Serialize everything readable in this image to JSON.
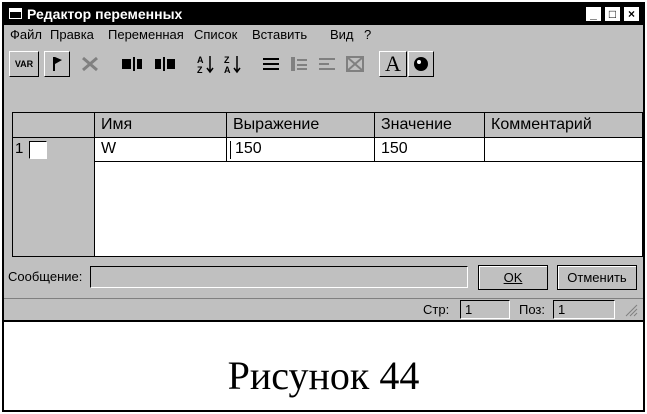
{
  "window": {
    "title": "Редактор переменных",
    "buttons": [
      "_",
      "□",
      "×"
    ]
  },
  "menu": [
    {
      "label": "Файл"
    },
    {
      "label": "Правка"
    },
    {
      "label": "Переменная"
    },
    {
      "label": "Список"
    },
    {
      "label": "Вставить"
    },
    {
      "label": "Вид"
    },
    {
      "label": "?"
    }
  ],
  "toolbar": {
    "var_label": "VAR",
    "font_label": "A"
  },
  "table": {
    "columns": [
      "Имя",
      "Выражение",
      "Значение",
      "Комментарий"
    ],
    "rows": [
      {
        "index": "1",
        "name": "W",
        "expression": "150",
        "value": "150",
        "comment": ""
      }
    ]
  },
  "message": {
    "label": "Сообщение:",
    "value": ""
  },
  "buttons": {
    "ok": "OK",
    "cancel": "Отменить"
  },
  "statusbar": {
    "page_label": "Стр:",
    "page_value": "1",
    "pos_label": "Поз:",
    "pos_value": "1"
  },
  "caption": "Рисунок 44"
}
